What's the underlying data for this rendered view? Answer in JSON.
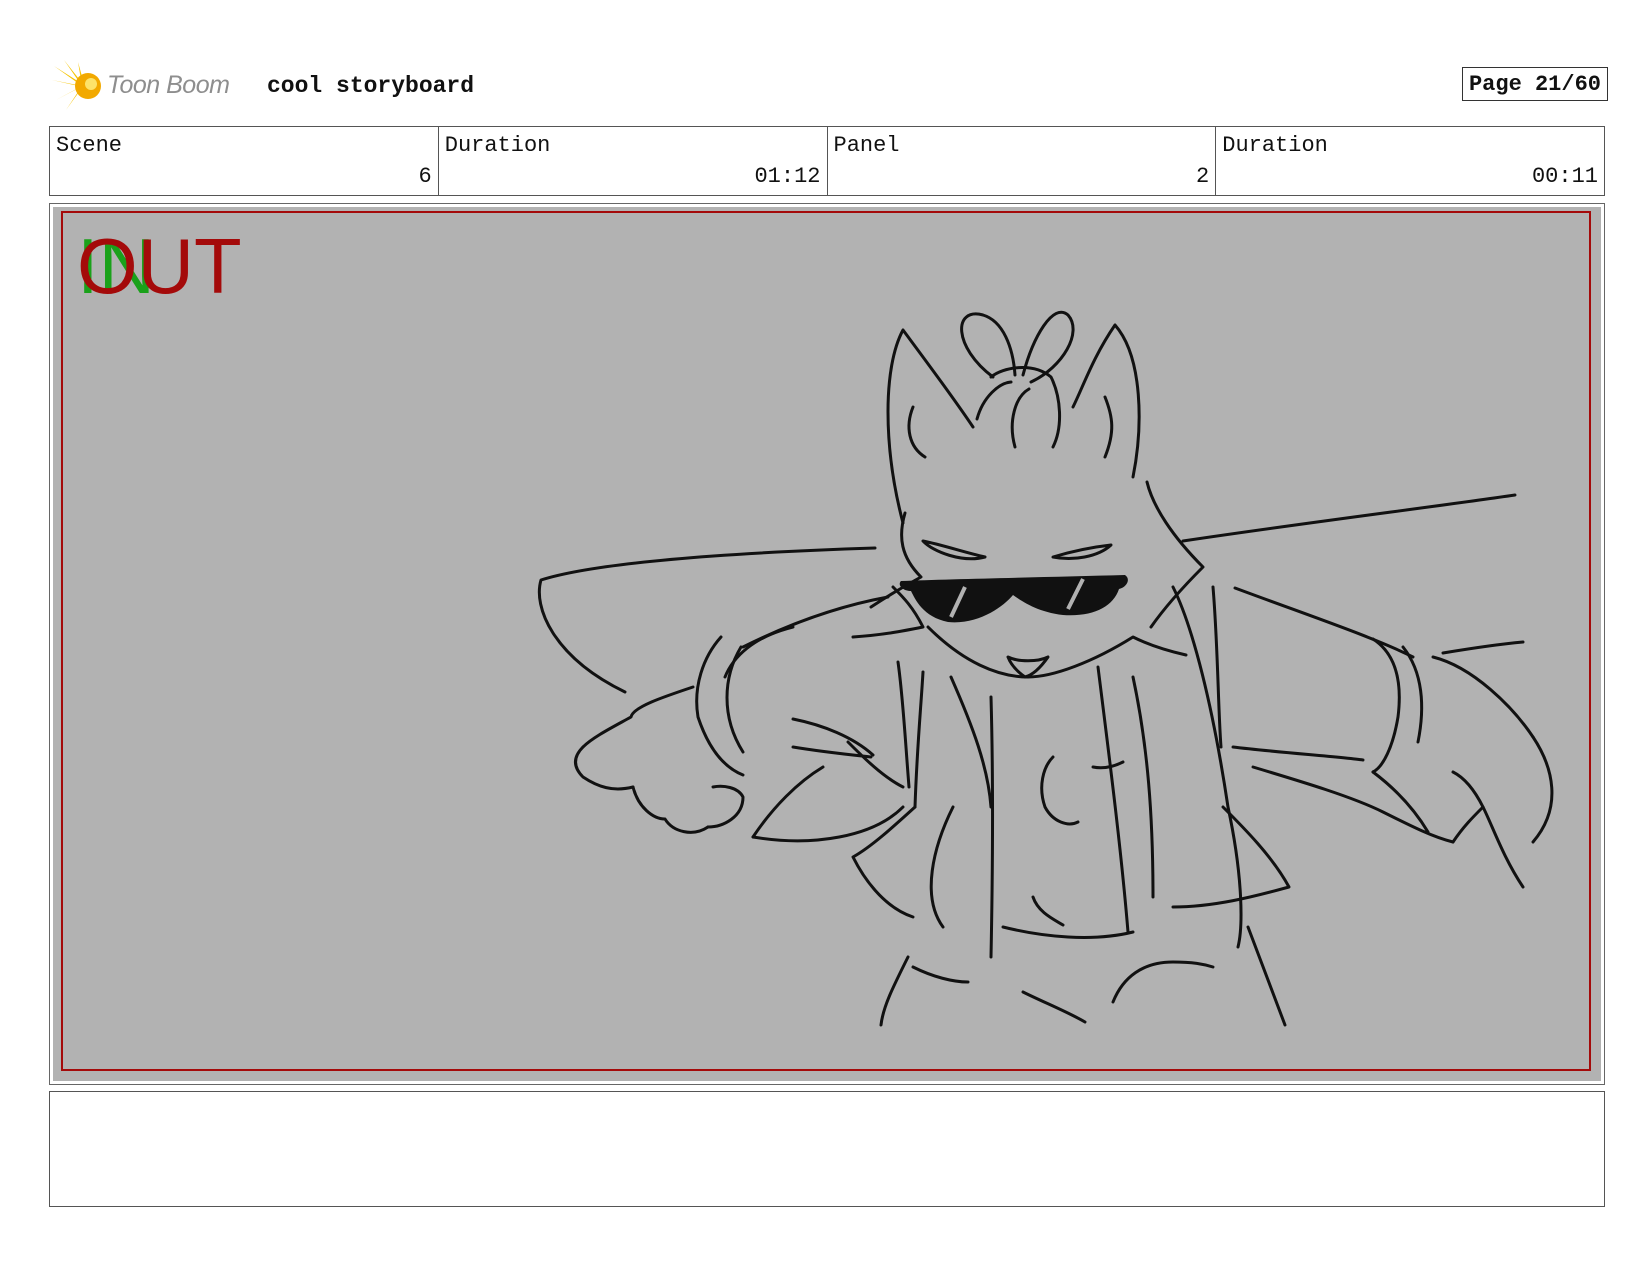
{
  "header": {
    "logo_text": "Toon Boom",
    "logo_icon": "toon-boom-burst-icon",
    "title": "cool storyboard",
    "page": "Page 21/60"
  },
  "info": [
    {
      "label": "Scene",
      "value": "6"
    },
    {
      "label": "Duration",
      "value": "01:12"
    },
    {
      "label": "Panel",
      "value": "2"
    },
    {
      "label": "Duration",
      "value": "00:11"
    }
  ],
  "panel": {
    "in_label": "IN",
    "out_label": "OUT",
    "in_color": "#1aa11a",
    "out_color": "#a40a0a",
    "background_color": "#b2b2b2"
  },
  "notes": {
    "text": ""
  }
}
